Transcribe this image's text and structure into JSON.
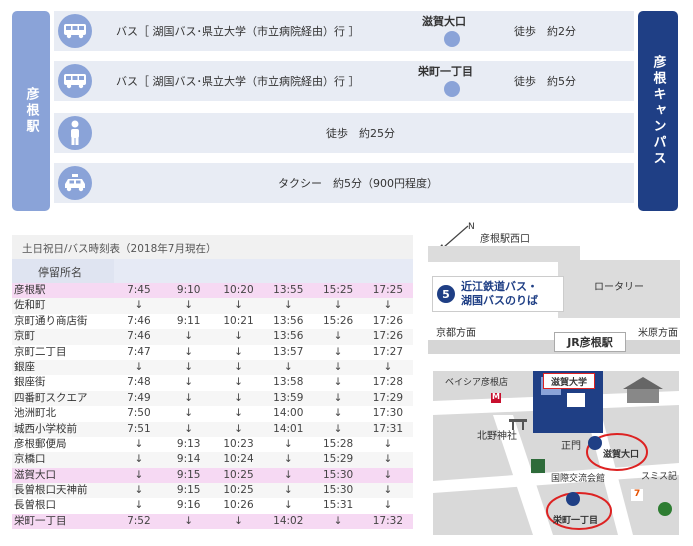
{
  "route": {
    "origin": "彦根駅",
    "destination": "彦根キャンパス",
    "rows": [
      {
        "icon": "bus-icon",
        "text": "バス［ 湖国バス･県立大学（市立病院経由）行 ］",
        "stop": "滋賀大口",
        "walk": "徒歩　約2分"
      },
      {
        "icon": "bus-icon",
        "text": "バス［ 湖国バス･県立大学（市立病院経由）行 ］",
        "stop": "栄町一丁目",
        "walk": "徒歩　約5分"
      },
      {
        "icon": "walk-icon",
        "text": "徒歩　約25分"
      },
      {
        "icon": "taxi-icon",
        "text": "タクシー　約5分（900円程度）"
      }
    ]
  },
  "timetable": {
    "title": "土日祝日/バス時刻表（2018年7月現在）",
    "header": "停留所名",
    "rows": [
      {
        "stop": "彦根駅",
        "times": [
          "7:45",
          "9:10",
          "10:20",
          "13:55",
          "15:25",
          "17:25"
        ],
        "hl": true
      },
      {
        "stop": "佐和町",
        "times": [
          "↓",
          "↓",
          "↓",
          "↓",
          "↓",
          "↓"
        ]
      },
      {
        "stop": "京町通り商店街",
        "times": [
          "7:46",
          "9:11",
          "10:21",
          "13:56",
          "15:26",
          "17:26"
        ]
      },
      {
        "stop": "京町",
        "times": [
          "7:46",
          "↓",
          "↓",
          "13:56",
          "↓",
          "17:26"
        ]
      },
      {
        "stop": "京町二丁目",
        "times": [
          "7:47",
          "↓",
          "↓",
          "13:57",
          "↓",
          "17:27"
        ]
      },
      {
        "stop": "銀座",
        "times": [
          "↓",
          "↓",
          "↓",
          "↓",
          "↓",
          "↓"
        ]
      },
      {
        "stop": "銀座街",
        "times": [
          "7:48",
          "↓",
          "↓",
          "13:58",
          "↓",
          "17:28"
        ]
      },
      {
        "stop": "四番町スクエア",
        "times": [
          "7:49",
          "↓",
          "↓",
          "13:59",
          "↓",
          "17:29"
        ]
      },
      {
        "stop": "池洲町北",
        "times": [
          "7:50",
          "↓",
          "↓",
          "14:00",
          "↓",
          "17:30"
        ]
      },
      {
        "stop": "城西小学校前",
        "times": [
          "7:51",
          "↓",
          "↓",
          "14:01",
          "↓",
          "17:31"
        ]
      },
      {
        "stop": "彦根郵便局",
        "times": [
          "↓",
          "9:13",
          "10:23",
          "↓",
          "15:28",
          "↓"
        ]
      },
      {
        "stop": "京橋口",
        "times": [
          "↓",
          "9:14",
          "10:24",
          "↓",
          "15:29",
          "↓"
        ]
      },
      {
        "stop": "滋賀大口",
        "times": [
          "↓",
          "9:15",
          "10:25",
          "↓",
          "15:30",
          "↓"
        ],
        "hl": true
      },
      {
        "stop": "長曽根口天神前",
        "times": [
          "↓",
          "9:15",
          "10:25",
          "↓",
          "15:30",
          "↓"
        ]
      },
      {
        "stop": "長曽根口",
        "times": [
          "↓",
          "9:16",
          "10:26",
          "↓",
          "15:31",
          "↓"
        ]
      },
      {
        "stop": "栄町一丁目",
        "times": [
          "7:52",
          "↓",
          "↓",
          "14:02",
          "↓",
          "17:32"
        ],
        "hl": true
      }
    ]
  },
  "mapA": {
    "north": "N",
    "west_exit": "彦根駅西口",
    "rotary": "ロータリー",
    "bus_stop_no": "5",
    "bus_stop_line1": "近江鉄道バス・",
    "bus_stop_line2": "湖国バスのりば",
    "kyoto": "京都方面",
    "maibara": "米原方面",
    "station": "JR彦根駅"
  },
  "mapB": {
    "hotel": "ベイシア彦根店",
    "univ": "滋賀大学",
    "shrine": "北野神社",
    "gate": "正門",
    "stop1": "滋賀大口",
    "stop2": "栄町一丁目",
    "hall": "国際交流会館",
    "sumisu": "スミス記",
    "mcd": "M",
    "seven": "7"
  }
}
